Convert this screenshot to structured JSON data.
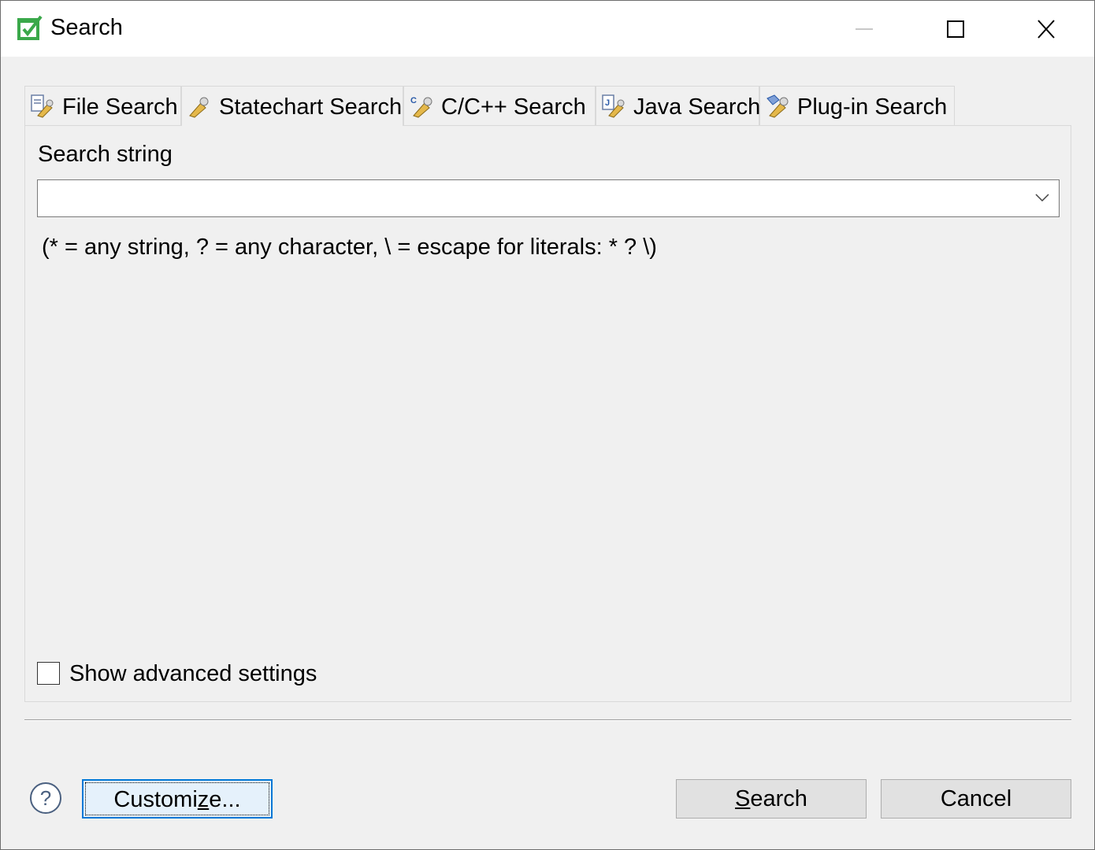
{
  "window": {
    "title": "Search",
    "controls": [
      "minimize-icon",
      "maximize-icon",
      "close-icon"
    ]
  },
  "tabs": [
    {
      "label": "File Search",
      "icon": "file-search-icon"
    },
    {
      "label": "Statechart Search",
      "icon": "statechart-search-icon",
      "active": true
    },
    {
      "label": "C/C++ Search",
      "icon": "cpp-search-icon"
    },
    {
      "label": "Java Search",
      "icon": "java-search-icon"
    },
    {
      "label": "Plug-in Search",
      "icon": "plugin-search-icon"
    }
  ],
  "form": {
    "search_label": "Search string",
    "search_value": "",
    "hint": "(* = any string, ? = any character, \\ = escape for literals: * ? \\)",
    "advanced_label": "Show advanced settings",
    "advanced_checked": false
  },
  "buttons": {
    "customize_pre": "Customi",
    "customize_mnemonic": "z",
    "customize_post": "e...",
    "search_mnemonic": "S",
    "search_rest": "earch",
    "cancel": "Cancel"
  },
  "colors": {
    "accent": "#0078d7",
    "app_icon_green": "#3aa84a"
  }
}
